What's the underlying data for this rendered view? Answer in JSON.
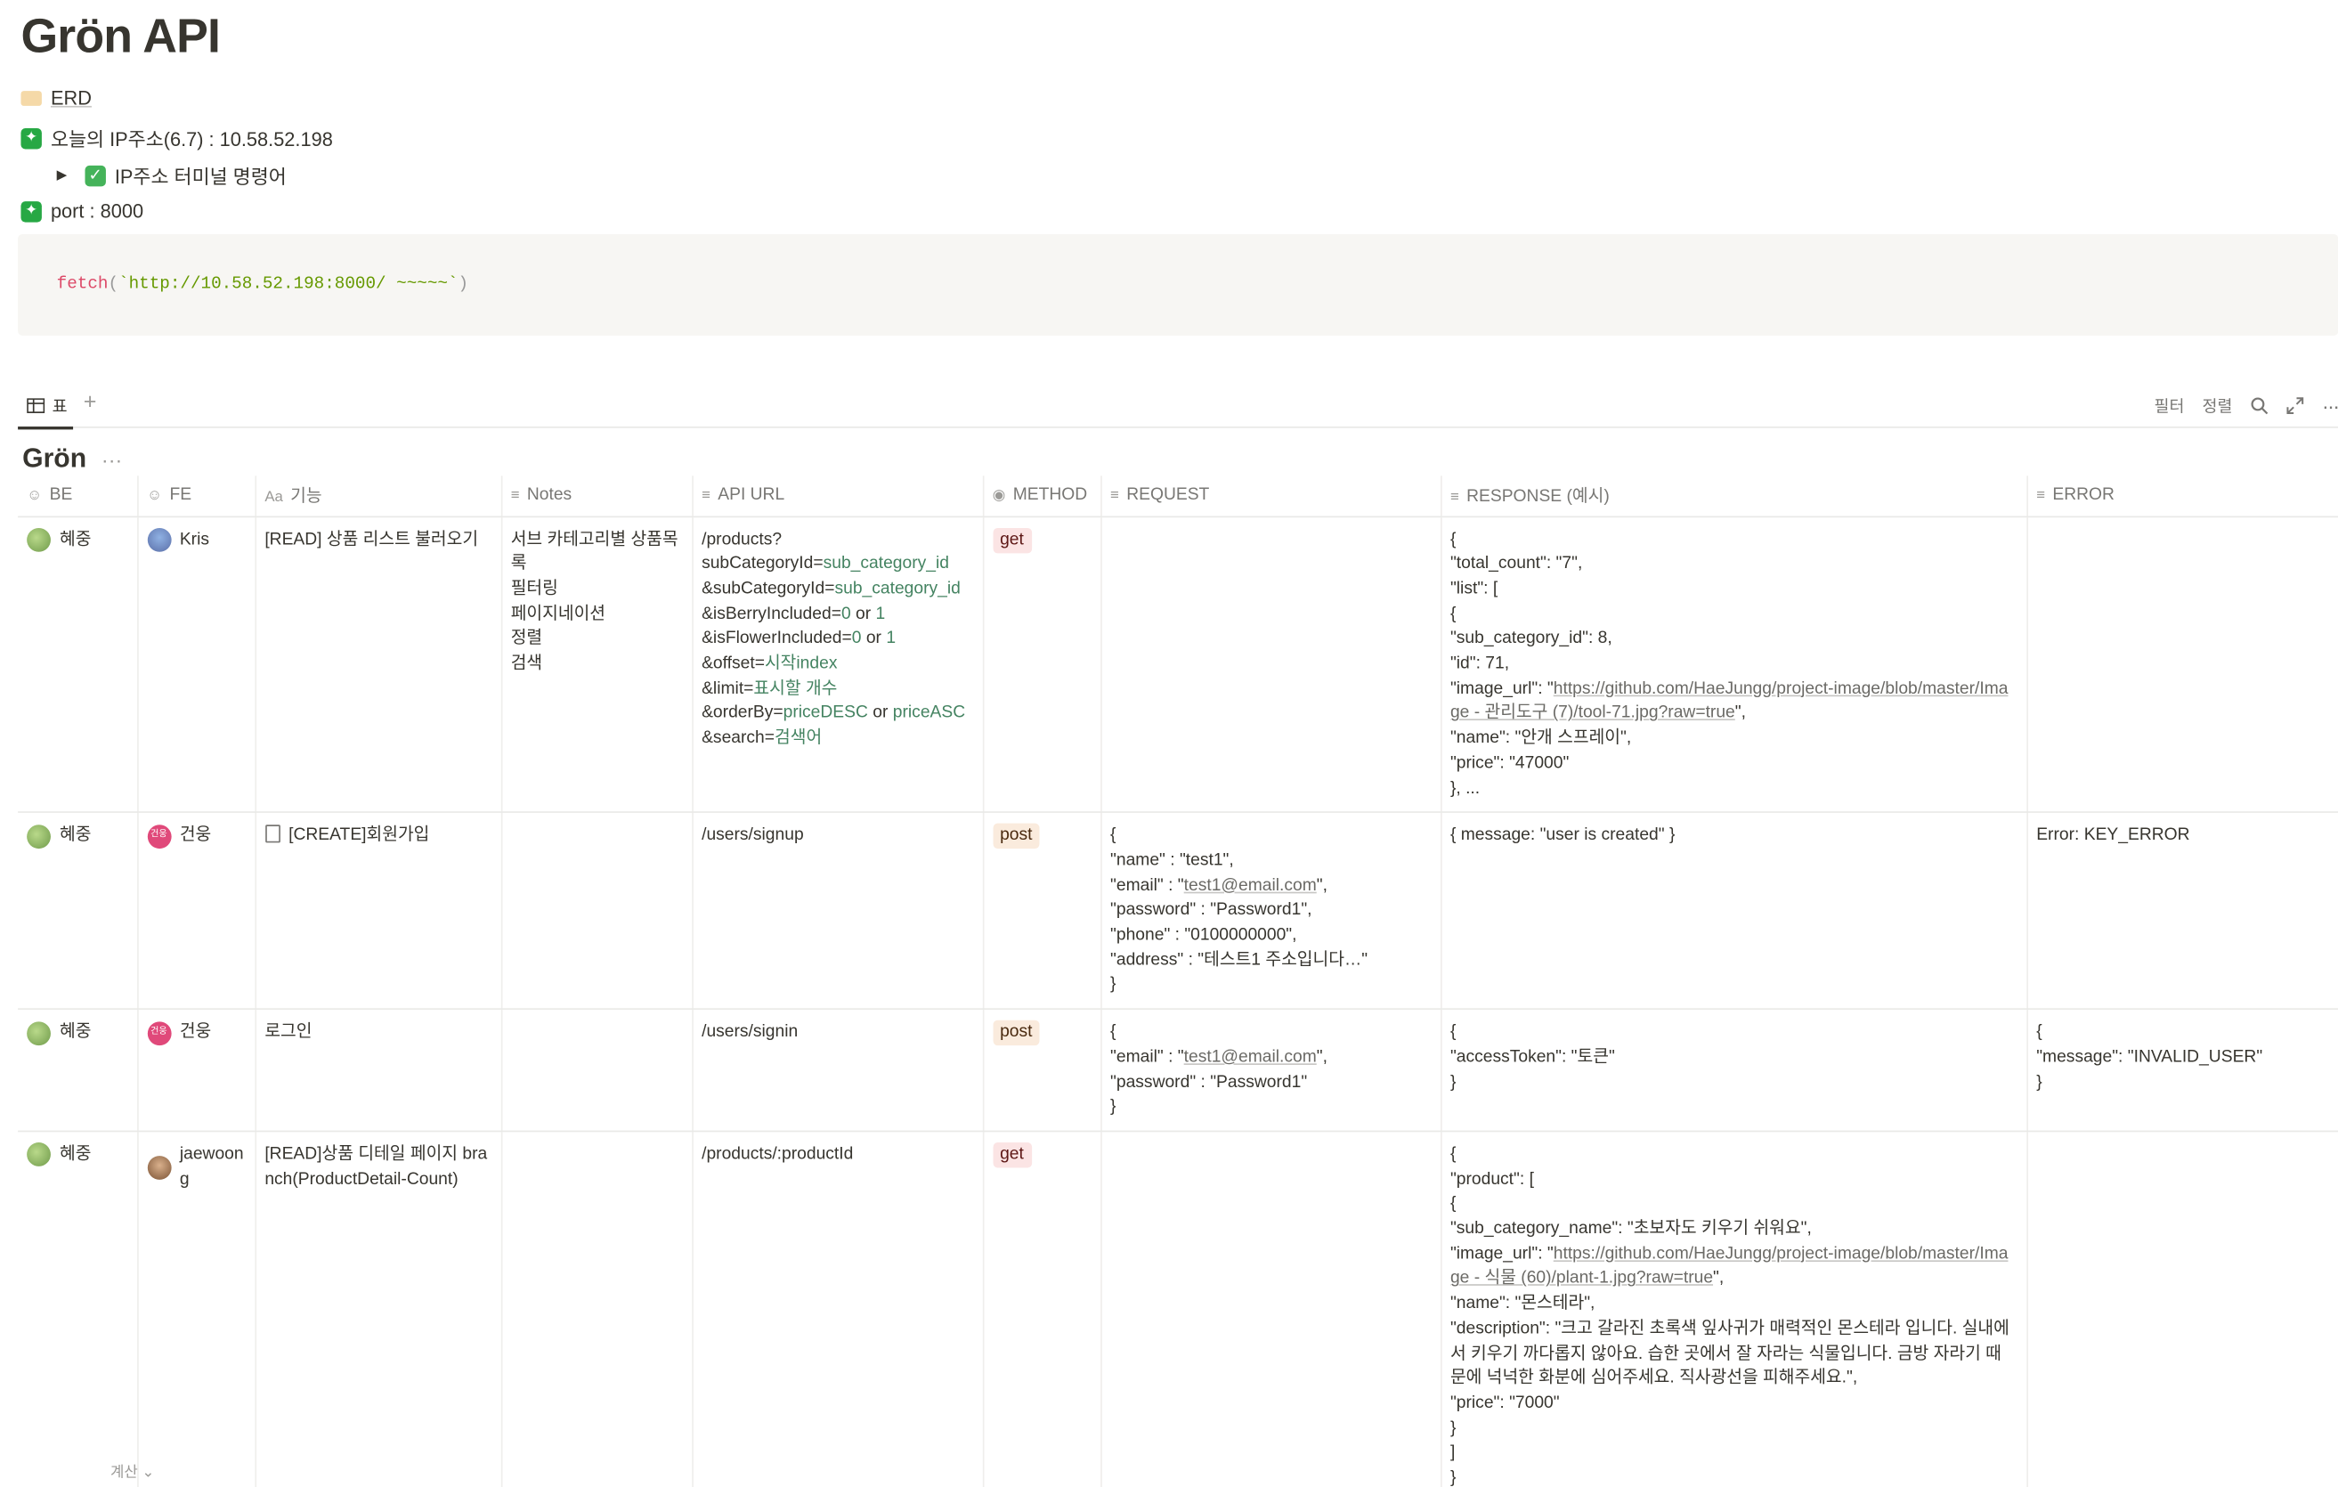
{
  "page": {
    "title": "Grön API",
    "erd_link": "ERD",
    "ip_line": "오늘의 IP주소(6.7) : 10.58.52.198",
    "ip_toggle": "IP주소 터미널 명령어",
    "port_line": "port : 8000",
    "code": {
      "fn": "fetch",
      "open": "(",
      "str": "`http://10.58.52.198:8000/ ~~~~~`",
      "close": ")"
    }
  },
  "view": {
    "tab_label": "표",
    "tools": {
      "filter": "필터",
      "sort": "정렬"
    }
  },
  "database": {
    "title": "Grön"
  },
  "table": {
    "columns": [
      {
        "key": "be",
        "label": "BE",
        "icon": "person-icon"
      },
      {
        "key": "fe",
        "label": "FE",
        "icon": "person-icon"
      },
      {
        "key": "feature",
        "label": "기능",
        "prefix": "Aa"
      },
      {
        "key": "notes",
        "label": "Notes",
        "icon": "text-icon"
      },
      {
        "key": "api_url",
        "label": "API URL",
        "icon": "text-icon"
      },
      {
        "key": "method",
        "label": "METHOD",
        "icon": "select-icon"
      },
      {
        "key": "request",
        "label": "REQUEST",
        "icon": "text-icon"
      },
      {
        "key": "response",
        "label": "RESPONSE (예시)",
        "icon": "text-icon"
      },
      {
        "key": "error",
        "label": "ERROR",
        "icon": "text-icon"
      }
    ],
    "rows": [
      {
        "be": "혜중",
        "fe": "Kris",
        "feature": "[READ] 상품 리스트 불러오기",
        "notes": [
          "서브 카테고리별 상품목록",
          "필터링",
          "페이지네이션",
          "정렬",
          "검색"
        ],
        "api_url": [
          [
            "/products?"
          ],
          [
            "subCategoryId=",
            "sub_category_id"
          ],
          [
            "&subCategoryId=",
            "sub_category_id"
          ],
          [
            "&isBerryIncluded=",
            "0",
            " or ",
            "1"
          ],
          [
            "&isFlowerIncluded=",
            "0",
            " or ",
            "1"
          ],
          [
            "&offset=",
            "시작index"
          ],
          [
            "&limit=",
            "표시할 개수"
          ],
          [
            "&orderBy=",
            "priceDESC",
            " or ",
            "priceASC"
          ],
          [
            "&search=",
            "검색어"
          ]
        ],
        "method": "get",
        "request": [],
        "response": [
          "{",
          "\"total_count\": \"7\",",
          "\"list\": [",
          "{",
          "\"sub_category_id\": 8,",
          "\"id\": 71,",
          "\"image_url\": \"",
          "https://github.com/HaeJungg/project-image/blob/master/Image - 관리도구 (7)/tool-71.jpg?raw=true",
          "\",",
          "\"name\": \"안개 스프레이\",",
          "\"price\": \"47000\"",
          "}, ..."
        ],
        "error": []
      },
      {
        "be": "혜중",
        "fe": "건웅",
        "feature": "[CREATE]회원가입",
        "notes": [],
        "api_url": [
          [
            "/users/signup"
          ]
        ],
        "method": "post",
        "request": [
          "{",
          "\"name\" : \"test1\",",
          "\"email\" : \"",
          "test1@email.com",
          "\",",
          "\"password\" : \"Password1\",",
          "\"phone\" : \"0100000000\",",
          "\"address\" : \"테스트1 주소입니다…\"",
          "}"
        ],
        "response": [
          "{ message: \"user is created\" }"
        ],
        "error": [
          "Error: KEY_ERROR"
        ]
      },
      {
        "be": "혜중",
        "fe": "건웅",
        "feature": "로그인",
        "notes": [],
        "api_url": [
          [
            "/users/signin"
          ]
        ],
        "method": "post",
        "request": [
          "{",
          "\"email\" : \"",
          "test1@email.com",
          "\",",
          "\"password\" : \"Password1\"",
          "}"
        ],
        "response": [
          "{",
          "\"accessToken\": \"토큰\"",
          "}"
        ],
        "error": [
          "{",
          "\"message\": \"INVALID_USER\"",
          "}"
        ]
      },
      {
        "be": "혜중",
        "fe": "jaewoong",
        "feature": "[READ]상품 디테일 페이지 branch(ProductDetail-Count)",
        "notes": [],
        "api_url": [
          [
            "/products/:productId"
          ]
        ],
        "method": "get",
        "request": [],
        "response": [
          "{",
          "\"product\": [",
          "{",
          "\"sub_category_name\": \"초보자도 키우기 쉬워요\",",
          "\"image_url\": \"",
          "https://github.com/HaeJungg/project-image/blob/master/Image - 식물 (60)/plant-1.jpg?raw=true",
          "\",",
          "\"name\": \"몬스테라\",",
          "\"description\": \"크고 갈라진 초록색 잎사귀가 매력적인 몬스테라 입니다. 실내에서 키우기 까다롭지 않아요. 습한 곳에서 잘 자라는 식물입니다. 금방 자라기 때문에 넉넉한 화분에 심어주세요. 직사광선을 피해주세요.\",",
          "\"price\": \"7000\"",
          "}",
          "]",
          "}"
        ],
        "error": []
      }
    ]
  },
  "footer": {
    "calc": "계산"
  }
}
